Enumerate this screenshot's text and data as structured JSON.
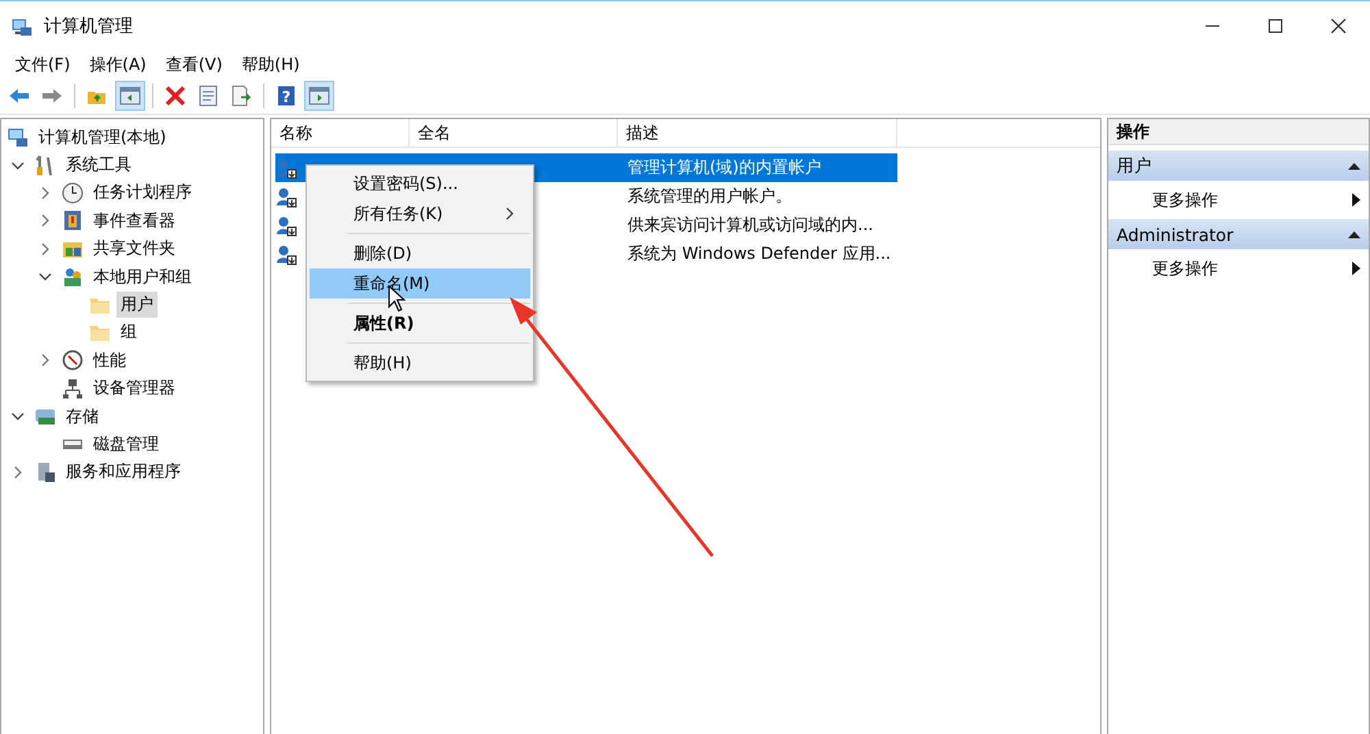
{
  "window": {
    "title": "计算机管理"
  },
  "menu_bar": [
    "文件(F)",
    "操作(A)",
    "查看(V)",
    "帮助(H)"
  ],
  "toolbar": [
    {
      "kind": "back",
      "pressed": false
    },
    {
      "kind": "forward",
      "pressed": false
    },
    {
      "kind": "separator"
    },
    {
      "kind": "up",
      "pressed": false
    },
    {
      "kind": "tree",
      "pressed": true
    },
    {
      "kind": "separator"
    },
    {
      "kind": "delete",
      "pressed": false
    },
    {
      "kind": "properties",
      "pressed": false
    },
    {
      "kind": "export",
      "pressed": false
    },
    {
      "kind": "separator"
    },
    {
      "kind": "help",
      "label": "?",
      "pressed": false
    },
    {
      "kind": "pane",
      "pressed": true
    }
  ],
  "tree": [
    {
      "label": "计算机管理(本地)",
      "kind": "computer",
      "selected": false,
      "children": [
        {
          "label": "系统工具",
          "kind": "tools",
          "expanded": true,
          "selected": false,
          "children": [
            {
              "label": "任务计划程序",
              "kind": "clock",
              "expanded": false,
              "selected": false
            },
            {
              "label": "事件查看器",
              "kind": "event",
              "expanded": false,
              "selected": false
            },
            {
              "label": "共享文件夹",
              "kind": "share",
              "expanded": false,
              "selected": false
            },
            {
              "label": "本地用户和组",
              "kind": "users",
              "expanded": true,
              "selected": false,
              "children": [
                {
                  "label": "用户",
                  "kind": "folder",
                  "selected": true
                },
                {
                  "label": "组",
                  "kind": "folder",
                  "selected": false
                }
              ]
            },
            {
              "label": "性能",
              "kind": "perf",
              "expanded": false,
              "selected": false
            },
            {
              "label": "设备管理器",
              "kind": "device",
              "selected": false
            }
          ]
        },
        {
          "label": "存储",
          "kind": "storage",
          "expanded": true,
          "selected": false,
          "children": [
            {
              "label": "磁盘管理",
              "kind": "disk",
              "selected": false
            }
          ]
        },
        {
          "label": "服务和应用程序",
          "kind": "services",
          "expanded": false,
          "selected": false
        }
      ]
    }
  ],
  "list": {
    "columns": [
      "名称",
      "全名",
      "描述"
    ],
    "rows": [
      {
        "description": "管理计算机(域)的内置帐户",
        "selected": true
      },
      {
        "description": "系统管理的用户帐户。",
        "selected": false
      },
      {
        "description": "供来宾访问计算机或访问域的内...",
        "selected": false
      },
      {
        "description": "系统为 Windows Defender 应用...",
        "selected": false
      }
    ]
  },
  "context_menu": [
    {
      "kind": "item",
      "label": "设置密码(S)...",
      "selected": false,
      "default": false,
      "submenu": false
    },
    {
      "kind": "item",
      "label": "所有任务(K)",
      "selected": false,
      "default": false,
      "submenu": true
    },
    {
      "kind": "separator"
    },
    {
      "kind": "item",
      "label": "删除(D)",
      "selected": false,
      "default": false,
      "submenu": false
    },
    {
      "kind": "item",
      "label": "重命名(M)",
      "selected": true,
      "default": false,
      "submenu": false
    },
    {
      "kind": "separator"
    },
    {
      "kind": "item",
      "label": "属性(R)",
      "selected": false,
      "default": true,
      "submenu": false
    },
    {
      "kind": "separator"
    },
    {
      "kind": "item",
      "label": "帮助(H)",
      "selected": false,
      "default": false,
      "submenu": false
    }
  ],
  "actions": {
    "title": "操作",
    "sections": [
      {
        "title": "用户",
        "expanded": true,
        "items": [
          "更多操作"
        ]
      },
      {
        "title": "Administrator",
        "expanded": true,
        "items": [
          "更多操作"
        ]
      }
    ]
  }
}
